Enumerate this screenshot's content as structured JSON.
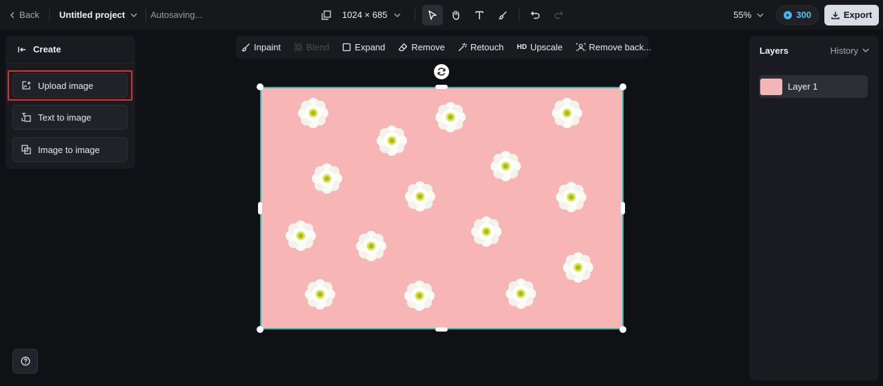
{
  "topbar": {
    "back_label": "Back",
    "project_name": "Untitled project",
    "status": "Autosaving...",
    "canvas_size": "1024 × 685",
    "zoom": "55%",
    "credits": "300",
    "export_label": "Export"
  },
  "left_panel": {
    "header": "Create",
    "items": [
      {
        "label": "Upload image",
        "icon": "upload-image-icon"
      },
      {
        "label": "Text to image",
        "icon": "text-to-image-icon"
      },
      {
        "label": "Image to image",
        "icon": "image-to-image-icon"
      }
    ]
  },
  "image_toolbar": {
    "items": [
      {
        "label": "Inpaint",
        "icon": "brush-icon",
        "enabled": true
      },
      {
        "label": "Blend",
        "icon": "blend-icon",
        "enabled": false
      },
      {
        "label": "Expand",
        "icon": "expand-icon",
        "enabled": true
      },
      {
        "label": "Remove",
        "icon": "eraser-icon",
        "enabled": true
      },
      {
        "label": "Retouch",
        "icon": "wand-icon",
        "enabled": true
      },
      {
        "label": "Upscale",
        "icon": "hd-icon",
        "icon_text": "HD",
        "enabled": true
      },
      {
        "label": "Remove back...",
        "icon": "remove-background-icon",
        "enabled": true
      }
    ]
  },
  "right_panel": {
    "title": "Layers",
    "history_label": "History",
    "layers": [
      {
        "label": "Layer 1"
      }
    ]
  },
  "colors": {
    "background": "#101115",
    "panel": "#1a1b20",
    "canvas_fill": "#f8b5b5",
    "selection_border": "#2fb8b0",
    "highlight": "#e03131",
    "credits_accent": "#4fc3f7"
  }
}
